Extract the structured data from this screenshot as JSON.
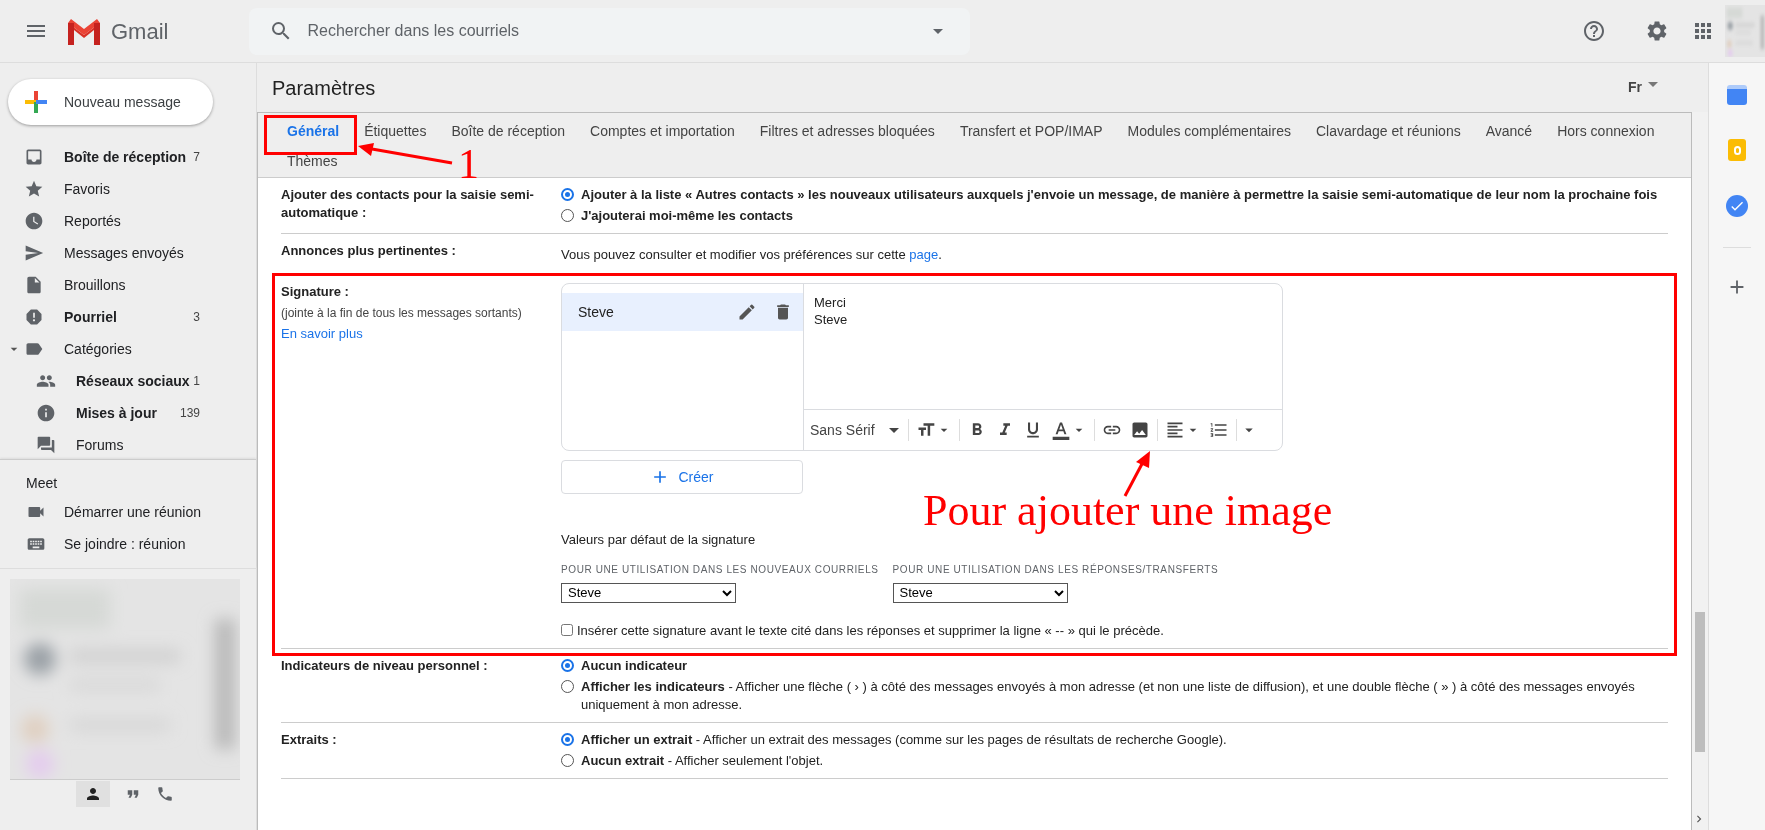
{
  "header": {
    "app_name": "Gmail",
    "search": {
      "placeholder": "Rechercher dans les courriels"
    }
  },
  "compose": "Nouveau message",
  "sidebar": {
    "items": [
      {
        "label": "Boîte de réception",
        "count": "7",
        "unread": true
      },
      {
        "label": "Favoris",
        "unread": false
      },
      {
        "label": "Reportés",
        "unread": false
      },
      {
        "label": "Messages envoyés",
        "unread": false
      },
      {
        "label": "Brouillons",
        "unread": false
      },
      {
        "label": "Pourriel",
        "count": "3",
        "unread": true
      },
      {
        "label": "Catégories",
        "unread": false,
        "expanded": true,
        "children": [
          {
            "label": "Réseaux sociaux",
            "count": "1",
            "unread": true
          },
          {
            "label": "Mises à jour",
            "count": "139",
            "unread": true
          },
          {
            "label": "Forums",
            "unread": false
          }
        ]
      }
    ]
  },
  "meet": {
    "title": "Meet",
    "items": [
      "Démarrer une réunion",
      "Se joindre : réunion"
    ]
  },
  "settings": {
    "title": "Paramètres",
    "language": "Fr",
    "tabs": [
      {
        "label": "Général",
        "selected": true
      },
      {
        "label": "Étiquettes",
        "selected": false
      },
      {
        "label": "Boîte de réception",
        "selected": false
      },
      {
        "label": "Comptes et importation",
        "selected": false
      },
      {
        "label": "Filtres et adresses bloquées",
        "selected": false
      },
      {
        "label": "Transfert et POP/IMAP",
        "selected": false
      },
      {
        "label": "Modules complémentaires",
        "selected": false
      },
      {
        "label": "Clavardage et réunions",
        "selected": false
      },
      {
        "label": "Avancé",
        "selected": false
      },
      {
        "label": "Hors connexion",
        "selected": false
      },
      {
        "label": "Thèmes",
        "selected": false
      }
    ],
    "rows": [
      {
        "kind": "radio",
        "label": "Ajouter des contacts pour la saisie semi-automatique :",
        "options": [
          {
            "title": "Ajouter à la liste « Autres contacts » les nouveaux utilisateurs auxquels j'envoie un message, de manière à permettre la saisie semi-automatique de leur nom la prochaine fois",
            "selected": true
          },
          {
            "title": "J'ajouterai moi-même les contacts",
            "selected": false
          }
        ]
      },
      {
        "kind": "text",
        "label": "Annonces plus pertinentes :",
        "text": "Vous pouvez consulter et modifier vos préférences sur cette",
        "link": "page",
        "suffix": "."
      },
      {
        "kind": "signature",
        "label": "Signature :",
        "note": "(jointe à la fin de tous les messages sortants)",
        "learn_more": "En savoir plus",
        "signatures": [
          {
            "name": "Steve",
            "selected": true
          }
        ],
        "editor_lines": [
          "Merci",
          "Steve"
        ],
        "font": "Sans Sérif",
        "create": "Créer",
        "defaults_title": "Valeurs par défaut de la signature",
        "selects": [
          {
            "label": "POUR UNE UTILISATION DANS LES NOUVEAUX COURRIELS",
            "value": "Steve"
          },
          {
            "label": "POUR UNE UTILISATION DANS LES RÉPONSES/TRANSFERTS",
            "value": "Steve"
          }
        ],
        "checkbox": {
          "label": "Insérer cette signature avant le texte cité dans les réponses et supprimer la ligne « -- » qui le précède.",
          "checked": false
        }
      },
      {
        "kind": "radio",
        "label": "Indicateurs de niveau personnel :",
        "options": [
          {
            "title": "Aucun indicateur",
            "selected": true
          },
          {
            "title": "Afficher les indicateurs",
            "desc": "- Afficher une flèche ( › ) à côté des messages envoyés à mon adresse (et non une liste de diffusion), et une double flèche ( » ) à côté des messages envoyés uniquement à mon adresse.",
            "selected": false
          }
        ]
      },
      {
        "kind": "radio",
        "label": "Extraits :",
        "options": [
          {
            "title": "Afficher un extrait",
            "desc": "- Afficher un extrait des messages (comme sur les pages de résultats de recherche Google).",
            "selected": true
          },
          {
            "title": "Aucun extrait",
            "desc": "- Afficher seulement l'objet.",
            "selected": false
          }
        ]
      }
    ]
  },
  "annotations": {
    "step_number": "1",
    "image_hint": "Pour ajouter une image"
  }
}
